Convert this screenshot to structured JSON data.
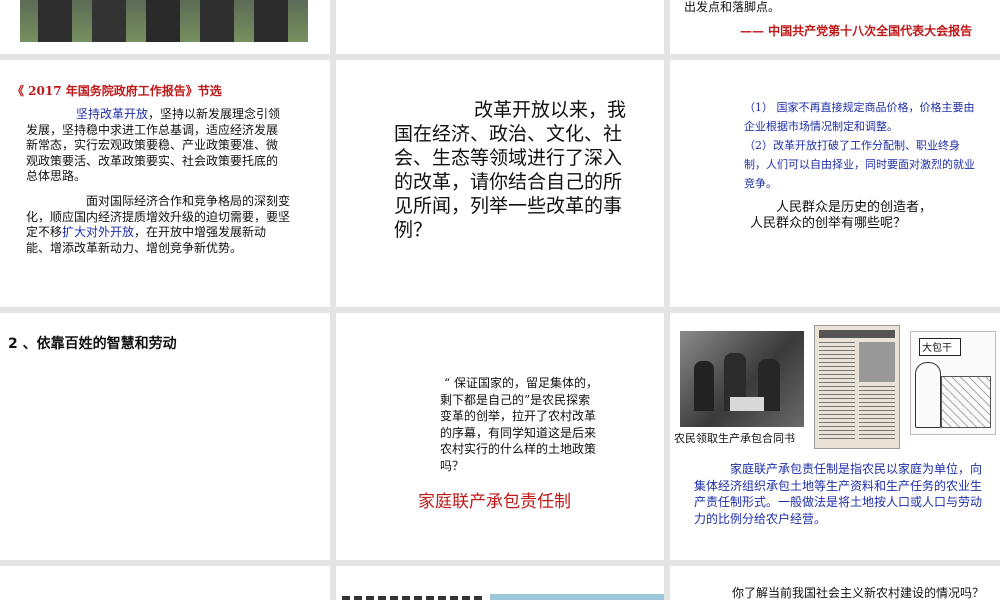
{
  "slide_r1c3": {
    "top_text": "出发点和落脚点。",
    "citation": "—— 中国共产党第十八次全国代表大会报告"
  },
  "slide_r2c1": {
    "title": "《 2017 年国务院政府工作报告》节选",
    "p1_lead": "坚持改革开放",
    "p1_rest": "，坚持以新发展理念引领发展，坚持稳中求进工作总基调，适应经济发展新常态，实行宏观政策要稳、产业政策要准、微观政策要活、改革政策要实、社会政策要托底的总体思路。",
    "p2_a": "面对国际经济合作和竞争格局的深刻变化，顺应国内经济提质增效升级的迫切需要，要坚定不移",
    "p2_highlight": "扩大对外开放",
    "p2_b": "，在开放中增强发展新动能、增添改革新动力、增创竞争新优势。"
  },
  "slide_r2c2": {
    "question": "改革开放以来，我国在经济、政治、文化、社会、生态等领域进行了深入的改革，请你结合自己的所见所闻，列举一些改革的事例？"
  },
  "slide_r2c3": {
    "point1": "（1） 国家不再直接规定商品价格，价格主要由企业根据市场情况制定和调整。",
    "point2": "（2）改革开放打破了工作分配制、职业终身制，人们可以自由择业，同时要面对激烈的就业竞争。",
    "q_line1": "人民群众是历史的创造者，",
    "q_line2": "人民群众的创举有哪些呢？"
  },
  "slide_r3c1": {
    "heading": "2 、依靠百姓的智慧和劳动"
  },
  "slide_r3c2": {
    "quote": "“ 保证国家的，留足集体的，剩下都是自己的”是农民探索变革的创举，拉开了农村改革的序幕，有同学知道这是后来农村实行的什么样的土地政策吗？",
    "answer": "家庭联产承包责任制"
  },
  "slide_r3c3": {
    "photo_caption": "农民领取生产承包合同书",
    "cartoon_text": "大包干",
    "definition": "家庭联产承包责任制是指农民以家庭为单位，向集体经济组织承包土地等生产资料和生产任务的农业生产责任制形式。一般做法是将土地按人口或人口与劳动力的比例分给农户经营。"
  },
  "slide_r4c3": {
    "question": "你了解当前我国社会主义新农村建设的情况吗？"
  },
  "colors": {
    "text": "#111111",
    "blue": "#1f2fa8",
    "red": "#c01818",
    "bg": "#e4e4e4"
  }
}
